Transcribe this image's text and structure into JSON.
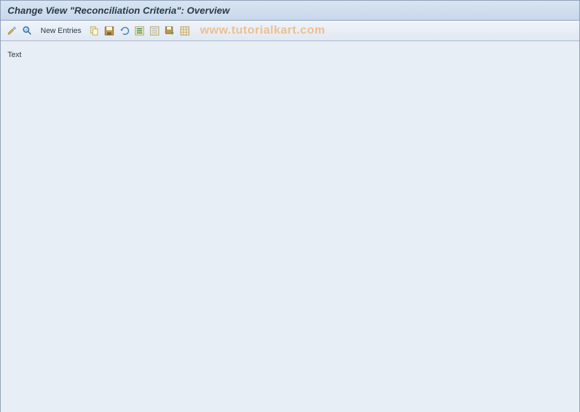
{
  "header": {
    "title": "Change View \"Reconciliation Criteria\": Overview"
  },
  "toolbar": {
    "new_entries_label": "New Entries"
  },
  "content": {
    "column_label": "Text"
  },
  "watermark": {
    "text": "www.tutorialkart.com"
  }
}
